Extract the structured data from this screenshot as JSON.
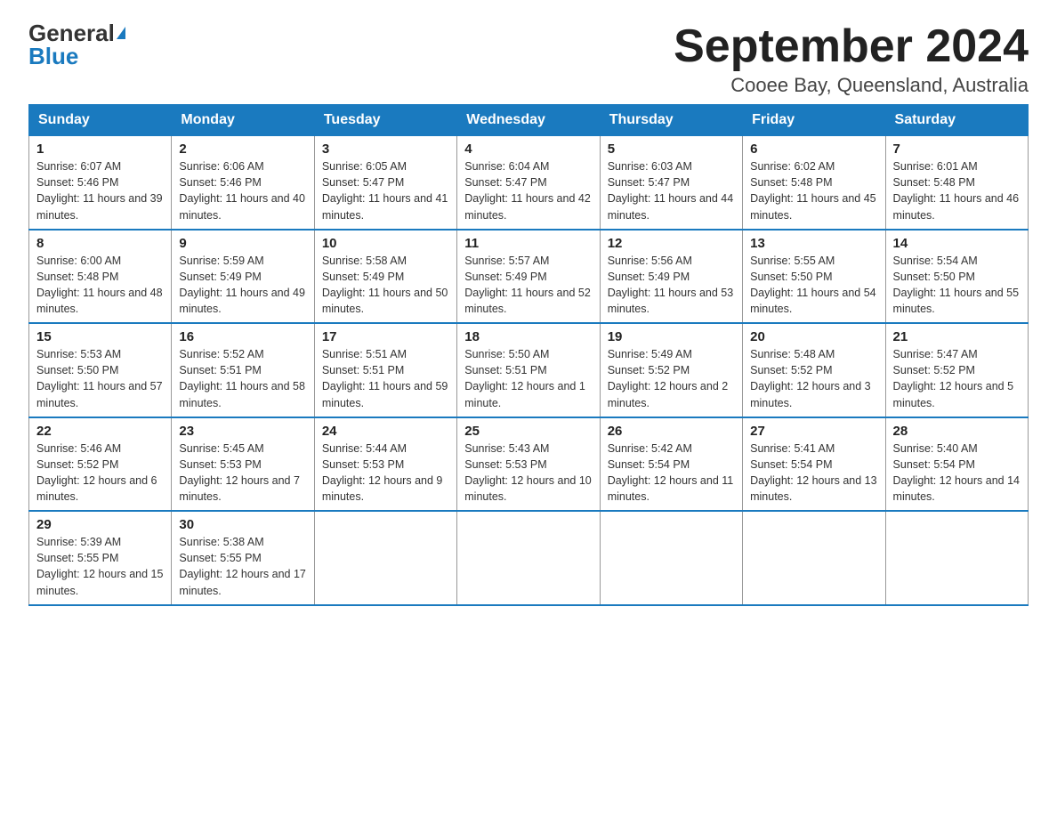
{
  "logo": {
    "general": "General",
    "blue": "Blue"
  },
  "title": "September 2024",
  "location": "Cooee Bay, Queensland, Australia",
  "days_of_week": [
    "Sunday",
    "Monday",
    "Tuesday",
    "Wednesday",
    "Thursday",
    "Friday",
    "Saturday"
  ],
  "weeks": [
    [
      {
        "day": "1",
        "sunrise": "6:07 AM",
        "sunset": "5:46 PM",
        "daylight": "11 hours and 39 minutes."
      },
      {
        "day": "2",
        "sunrise": "6:06 AM",
        "sunset": "5:46 PM",
        "daylight": "11 hours and 40 minutes."
      },
      {
        "day": "3",
        "sunrise": "6:05 AM",
        "sunset": "5:47 PM",
        "daylight": "11 hours and 41 minutes."
      },
      {
        "day": "4",
        "sunrise": "6:04 AM",
        "sunset": "5:47 PM",
        "daylight": "11 hours and 42 minutes."
      },
      {
        "day": "5",
        "sunrise": "6:03 AM",
        "sunset": "5:47 PM",
        "daylight": "11 hours and 44 minutes."
      },
      {
        "day": "6",
        "sunrise": "6:02 AM",
        "sunset": "5:48 PM",
        "daylight": "11 hours and 45 minutes."
      },
      {
        "day": "7",
        "sunrise": "6:01 AM",
        "sunset": "5:48 PM",
        "daylight": "11 hours and 46 minutes."
      }
    ],
    [
      {
        "day": "8",
        "sunrise": "6:00 AM",
        "sunset": "5:48 PM",
        "daylight": "11 hours and 48 minutes."
      },
      {
        "day": "9",
        "sunrise": "5:59 AM",
        "sunset": "5:49 PM",
        "daylight": "11 hours and 49 minutes."
      },
      {
        "day": "10",
        "sunrise": "5:58 AM",
        "sunset": "5:49 PM",
        "daylight": "11 hours and 50 minutes."
      },
      {
        "day": "11",
        "sunrise": "5:57 AM",
        "sunset": "5:49 PM",
        "daylight": "11 hours and 52 minutes."
      },
      {
        "day": "12",
        "sunrise": "5:56 AM",
        "sunset": "5:49 PM",
        "daylight": "11 hours and 53 minutes."
      },
      {
        "day": "13",
        "sunrise": "5:55 AM",
        "sunset": "5:50 PM",
        "daylight": "11 hours and 54 minutes."
      },
      {
        "day": "14",
        "sunrise": "5:54 AM",
        "sunset": "5:50 PM",
        "daylight": "11 hours and 55 minutes."
      }
    ],
    [
      {
        "day": "15",
        "sunrise": "5:53 AM",
        "sunset": "5:50 PM",
        "daylight": "11 hours and 57 minutes."
      },
      {
        "day": "16",
        "sunrise": "5:52 AM",
        "sunset": "5:51 PM",
        "daylight": "11 hours and 58 minutes."
      },
      {
        "day": "17",
        "sunrise": "5:51 AM",
        "sunset": "5:51 PM",
        "daylight": "11 hours and 59 minutes."
      },
      {
        "day": "18",
        "sunrise": "5:50 AM",
        "sunset": "5:51 PM",
        "daylight": "12 hours and 1 minute."
      },
      {
        "day": "19",
        "sunrise": "5:49 AM",
        "sunset": "5:52 PM",
        "daylight": "12 hours and 2 minutes."
      },
      {
        "day": "20",
        "sunrise": "5:48 AM",
        "sunset": "5:52 PM",
        "daylight": "12 hours and 3 minutes."
      },
      {
        "day": "21",
        "sunrise": "5:47 AM",
        "sunset": "5:52 PM",
        "daylight": "12 hours and 5 minutes."
      }
    ],
    [
      {
        "day": "22",
        "sunrise": "5:46 AM",
        "sunset": "5:52 PM",
        "daylight": "12 hours and 6 minutes."
      },
      {
        "day": "23",
        "sunrise": "5:45 AM",
        "sunset": "5:53 PM",
        "daylight": "12 hours and 7 minutes."
      },
      {
        "day": "24",
        "sunrise": "5:44 AM",
        "sunset": "5:53 PM",
        "daylight": "12 hours and 9 minutes."
      },
      {
        "day": "25",
        "sunrise": "5:43 AM",
        "sunset": "5:53 PM",
        "daylight": "12 hours and 10 minutes."
      },
      {
        "day": "26",
        "sunrise": "5:42 AM",
        "sunset": "5:54 PM",
        "daylight": "12 hours and 11 minutes."
      },
      {
        "day": "27",
        "sunrise": "5:41 AM",
        "sunset": "5:54 PM",
        "daylight": "12 hours and 13 minutes."
      },
      {
        "day": "28",
        "sunrise": "5:40 AM",
        "sunset": "5:54 PM",
        "daylight": "12 hours and 14 minutes."
      }
    ],
    [
      {
        "day": "29",
        "sunrise": "5:39 AM",
        "sunset": "5:55 PM",
        "daylight": "12 hours and 15 minutes."
      },
      {
        "day": "30",
        "sunrise": "5:38 AM",
        "sunset": "5:55 PM",
        "daylight": "12 hours and 17 minutes."
      },
      null,
      null,
      null,
      null,
      null
    ]
  ]
}
